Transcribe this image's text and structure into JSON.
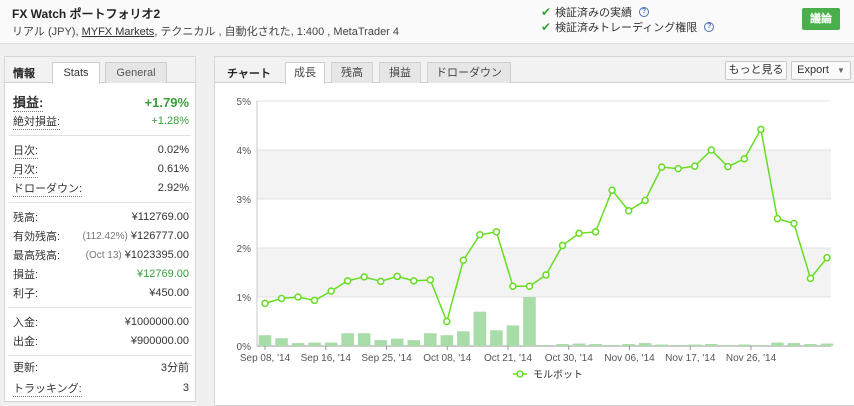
{
  "header": {
    "title": "FX Watch ポートフォリオ2",
    "subtitle_prefix": "リアル (JPY),",
    "subtitle_link": "MYFX Markets",
    "subtitle_suffix": ", テクニカル , 自動化された, 1:400 , MetaTrader 4",
    "verified_track": "検証済みの実績",
    "verified_trading": "検証済みトレーディング権限",
    "help_glyph": "?",
    "discuss_button": "議論",
    "colors": {
      "check": "#3aa03a",
      "discuss_bg": "#4aae4a"
    }
  },
  "left_panel": {
    "tab_label": "情報",
    "tab_stats": "Stats",
    "tab_general": "General",
    "gain_label": "損益:",
    "gain_value": "+1.79%",
    "abs_gain_label": "絶対損益:",
    "abs_gain_value": "+1.28%",
    "daily_label": "日次:",
    "daily_value": "0.02%",
    "monthly_label": "月次:",
    "monthly_value": "0.61%",
    "drawdown_label": "ドローダウン:",
    "drawdown_value": "2.92%",
    "balance_label": "残高:",
    "balance_value": "¥112769.00",
    "equity_label": "有効残高:",
    "equity_note": "(112.42%)",
    "equity_value": "¥126777.00",
    "highest_label": "最高残高:",
    "highest_note": "(Oct 13)",
    "highest_value": "¥1023395.00",
    "profit_label": "損益:",
    "profit_value": "¥12769.00",
    "interest_label": "利子:",
    "interest_value": "¥450.00",
    "deposits_label": "入金:",
    "deposits_value": "¥1000000.00",
    "withdrawals_label": "出金:",
    "withdrawals_value": "¥900000.00",
    "updated_label": "更新:",
    "updated_value": "3分前",
    "tracking_label": "トラッキング:",
    "tracking_value": "3"
  },
  "chart_panel": {
    "tab_label": "チャート",
    "tabs": [
      "成長",
      "残高",
      "損益",
      "ドローダウン"
    ],
    "more_button": "もっと見る",
    "export_button": "Export",
    "export_caret": "▼"
  },
  "chart_data": {
    "type": "line",
    "x_tick_labels": [
      "Sep 08, '14",
      "Sep 16, '14",
      "Sep 25, '14",
      "Oct 08, '14",
      "Oct 21, '14",
      "Oct 30, '14",
      "Nov 06, '14",
      "Nov 17, '14",
      "Nov 26, '14"
    ],
    "y_tick_labels": [
      "0%",
      "1%",
      "2%",
      "3%",
      "4%",
      "5%"
    ],
    "ylim": [
      0,
      5
    ],
    "grid": true,
    "legend": "bottom-center",
    "series": [
      {
        "name": "モルボット",
        "color": "#66dd22",
        "values": [
          0.87,
          0.97,
          1.0,
          0.93,
          1.12,
          1.33,
          1.41,
          1.32,
          1.42,
          1.33,
          1.35,
          0.5,
          1.75,
          2.27,
          2.33,
          1.22,
          1.22,
          1.45,
          2.05,
          2.3,
          2.33,
          3.18,
          2.76,
          2.97,
          3.65,
          3.62,
          3.67,
          4.0,
          3.66,
          3.82,
          4.42,
          2.6,
          2.5,
          1.38,
          1.8
        ]
      }
    ],
    "bars": {
      "color": "#a8dca8",
      "values": [
        0.22,
        0.16,
        0.06,
        0.07,
        0.07,
        0.26,
        0.26,
        0.12,
        0.15,
        0.12,
        0.26,
        0.22,
        0.3,
        0.7,
        0.32,
        0.42,
        1.0,
        0.02,
        0.04,
        0.05,
        0.04,
        0.02,
        0.04,
        0.06,
        0.03,
        0.02,
        0.03,
        0.04,
        0.02,
        0.03,
        0.02,
        0.07,
        0.06,
        0.04,
        0.05
      ]
    }
  }
}
